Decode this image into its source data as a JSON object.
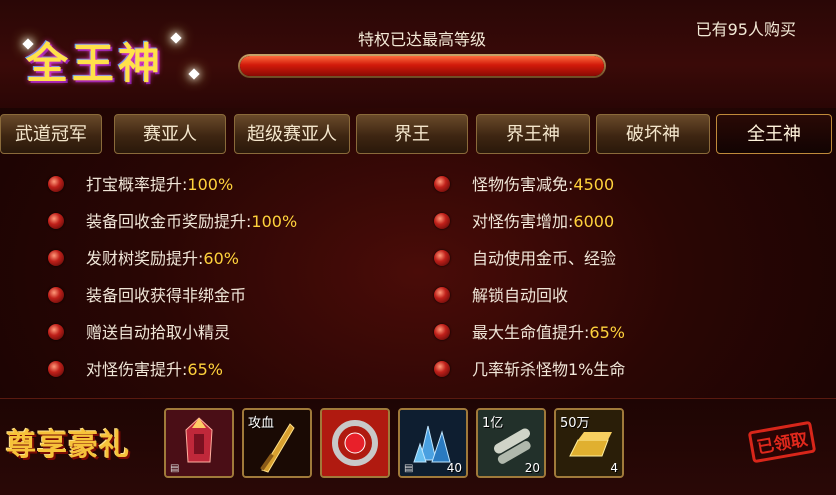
{
  "header": {
    "logo_text": "全王神",
    "privilege_title": "特权已达最高等级",
    "progress_fraction": 1.0,
    "buyers_text": "已有95人购买"
  },
  "tabs": [
    {
      "label": "武道冠军",
      "active": false
    },
    {
      "label": "赛亚人",
      "active": false
    },
    {
      "label": "超级赛亚人",
      "active": false
    },
    {
      "label": "界王",
      "active": false
    },
    {
      "label": "界王神",
      "active": false
    },
    {
      "label": "破坏神",
      "active": false
    },
    {
      "label": "全王神",
      "active": true
    }
  ],
  "perks_left": [
    {
      "text": "打宝概率提升:",
      "value": "100%"
    },
    {
      "text": "装备回收金币奖励提升:",
      "value": "100%"
    },
    {
      "text": "发财树奖励提升:",
      "value": "60%"
    },
    {
      "text": "装备回收获得非绑金币",
      "value": ""
    },
    {
      "text": "赠送自动拾取小精灵",
      "value": ""
    },
    {
      "text": "对怪伤害提升:",
      "value": "65%"
    }
  ],
  "perks_right": [
    {
      "text": "怪物伤害减免:",
      "value": "4500"
    },
    {
      "text": "对怪伤害增加:",
      "value": "6000"
    },
    {
      "text": "自动使用金币、经验",
      "value": ""
    },
    {
      "text": "解锁自动回收",
      "value": ""
    },
    {
      "text": "最大生命值提升:",
      "value": "65%"
    },
    {
      "text": "几率斩杀怪物1%生命",
      "value": ""
    }
  ],
  "footer": {
    "gift_title": "尊享豪礼",
    "claimed_label": "已领取",
    "items": [
      {
        "icon": "red-armor-icon",
        "tag": "",
        "count": "",
        "color_a": "#6a1a2a",
        "color_b": "#c0283a"
      },
      {
        "icon": "golden-sword-icon",
        "tag": "攻血",
        "count": "",
        "color_a": "#3a1a08",
        "color_b": "#8a5a18"
      },
      {
        "icon": "red-gem-ring-icon",
        "tag": "",
        "count": "",
        "color_a": "#8a0e0a",
        "color_b": "#e0301e"
      },
      {
        "icon": "blue-crystal-icon",
        "tag": "",
        "count": "40",
        "color_a": "#10304a",
        "color_b": "#3a8ac0"
      },
      {
        "icon": "scroll-icon",
        "tag": "1亿",
        "count": "20",
        "color_a": "#2a3a2a",
        "color_b": "#6a8a7a"
      },
      {
        "icon": "gold-ingot-icon",
        "tag": "50万",
        "count": "4",
        "color_a": "#3a2a08",
        "color_b": "#c09020"
      }
    ]
  }
}
